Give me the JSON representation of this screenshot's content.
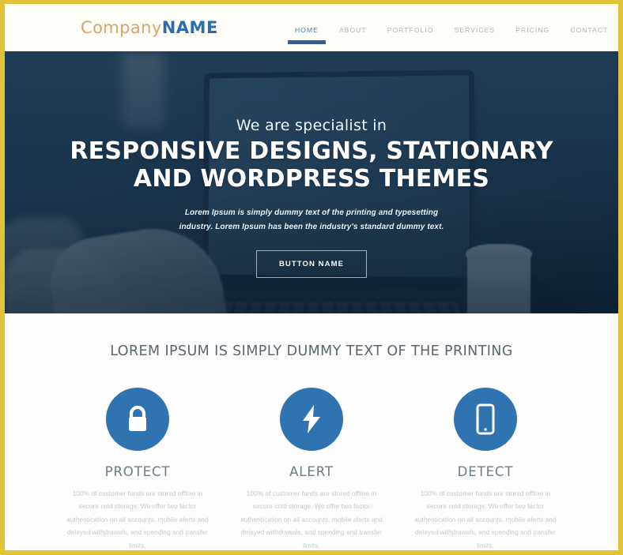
{
  "theme": {
    "frame_color": "#e0c337",
    "accent_blue": "#2f73b0",
    "logo_gold": "#d9a566",
    "logo_blue": "#2b6cb0",
    "hero_overlay": "#17344e"
  },
  "header": {
    "logo": {
      "first": "Company",
      "second": "NAME"
    },
    "nav": [
      {
        "label": "HOME",
        "active": true
      },
      {
        "label": "ABOUT",
        "active": false
      },
      {
        "label": "PORTFOLIO",
        "active": false
      },
      {
        "label": "SERVICES",
        "active": false
      },
      {
        "label": "PRICING",
        "active": false
      },
      {
        "label": "CONTACT",
        "active": false
      }
    ]
  },
  "hero": {
    "kicker": "We are specialist in",
    "title_line1": "RESPONSIVE DESIGNS, STATIONARY",
    "title_line2": "AND WORDPRESS THEMES",
    "subtitle": "Lorem Ipsum is simply dummy text of the printing and typesetting industry. Lorem Ipsum has been the industry's standard dummy text.",
    "button_label": "BUTTON NAME"
  },
  "features": {
    "heading": "LOREM IPSUM IS SIMPLY DUMMY TEXT OF THE PRINTING",
    "items": [
      {
        "icon": "lock-icon",
        "title": "PROTECT",
        "body": "100% of customer funds are stored offline in secure cold storage. We offer two factor authentication on all accounts, mobile alerts and delayed withdrawals, and spending and transfer limits."
      },
      {
        "icon": "lightning-bolt-icon",
        "title": "ALERT",
        "body": "100% of customer funds are stored offline in secure cold storage. We offer two factor authentication on all accounts, mobile alerts and delayed withdrawals, and spending and transfer limits."
      },
      {
        "icon": "mobile-phone-icon",
        "title": "DETECT",
        "body": "100% of customer funds are stored offline in secure cold storage. We offer two factor authentication on all accounts, mobile alerts and delayed withdrawals, and spending and transfer limits."
      }
    ]
  }
}
